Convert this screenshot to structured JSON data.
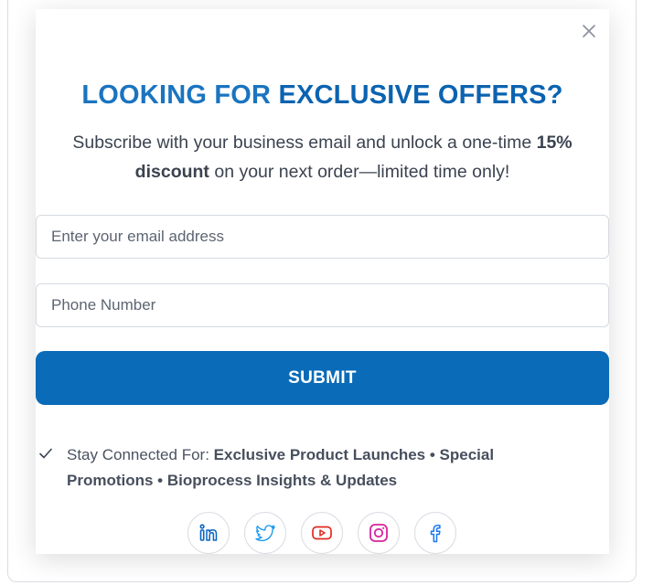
{
  "popup": {
    "headline_light": "LOOKING FOR",
    "headline_strong": "EXCLUSIVE OFFERS?",
    "subtext_start": "Subscribe with your business email and unlock a one-time",
    "subtext_bold": "15% discount",
    "subtext_end": "on your next order—limited time only!",
    "email_placeholder": "Enter your email address",
    "phone_placeholder": "Phone Number",
    "submit_label": "SUBMIT",
    "stay_prefix": "Stay Connected For:",
    "stay_items": "Exclusive Product Launches • Special Promotions • Bioprocess Insights & Updates",
    "close_icon": "close-icon",
    "check_icon": "check-icon",
    "social_icons": [
      "linkedin-icon",
      "twitter-icon",
      "youtube-icon",
      "instagram-icon",
      "facebook-icon"
    ]
  },
  "colors": {
    "accent": "#0a6bb8",
    "headline": "#0b63b0",
    "linkedin": "#0a66c2",
    "twitter": "#1d9bf0",
    "youtube": "#e02b20",
    "instagram": "#d6249f",
    "facebook": "#1877f2"
  }
}
